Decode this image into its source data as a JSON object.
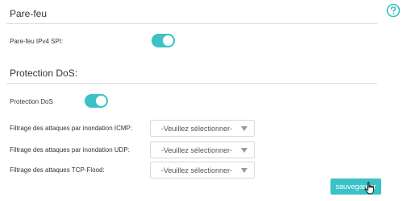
{
  "firewall": {
    "title": "Pare-feu",
    "spi_label": "Pare-feu IPv4 SPI:",
    "spi_enabled": true
  },
  "dos": {
    "title": "Protection DoS:",
    "protection_label": "Protection DoS",
    "protection_enabled": true,
    "filters": [
      {
        "label": "Filtrage des attaques par inondation ICMP:",
        "value": "-Veuillez sélectionner-"
      },
      {
        "label": "Filtrage des attaques par inondation UDP:",
        "value": "-Veuillez sélectionner-"
      },
      {
        "label": "Filtrage des attaques TCP-Flood:",
        "value": "-Veuillez sélectionner-"
      }
    ]
  },
  "actions": {
    "save_label": "sauvegarder"
  },
  "icons": {
    "help": "question-circle-icon",
    "cursor": "hand-pointer-icon"
  },
  "colors": {
    "accent": "#3bc1c6",
    "divider": "#dcdcdc"
  }
}
